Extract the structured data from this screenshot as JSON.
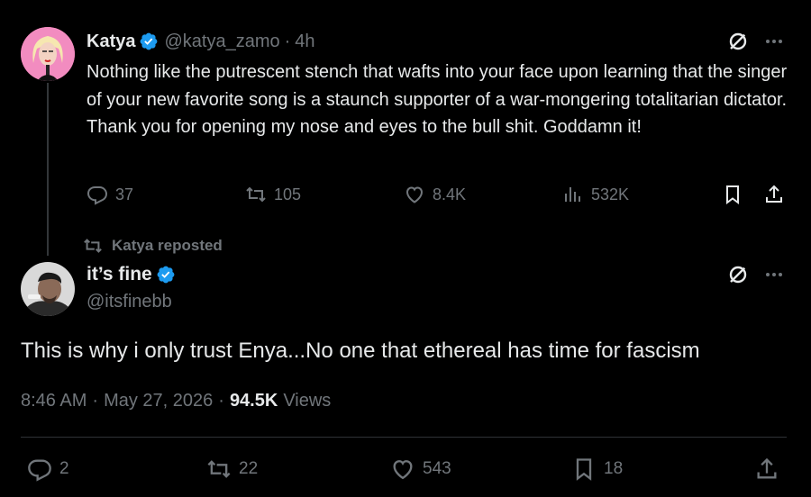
{
  "colors": {
    "background": "#000000",
    "text_primary": "#e7e9ea",
    "text_secondary": "#71767b",
    "verified_badge": "#1d9bf0",
    "divider": "#2f3336"
  },
  "quoted_tweet": {
    "author_name": "Katya",
    "verified": true,
    "handle": "@katya_zamo",
    "separator": "·",
    "time": "4h",
    "text": "Nothing like the putrescent stench that wafts into your face upon learning that the singer of your new favorite song is a staunch supporter of a war-mongering totalitarian dictator. Thank you for opening my nose and eyes to the bull shit. Goddamn it!",
    "actions": {
      "replies": "37",
      "reposts": "105",
      "likes": "8.4K",
      "views": "532K"
    },
    "icons": [
      "grok-icon",
      "more-icon",
      "reply-icon",
      "repost-icon",
      "like-icon",
      "views-icon",
      "bookmark-icon",
      "share-icon"
    ]
  },
  "repost_indicator": {
    "label": "Katya reposted"
  },
  "main_tweet": {
    "author_name": "it’s fine",
    "verified": true,
    "handle": "@itsfinebb",
    "text": "This is why i only trust Enya...No one that ethereal has time for fascism",
    "time": "8:46 AM",
    "separator": "·",
    "date": "May 27, 2026",
    "views_count": "94.5K",
    "views_label": "Views",
    "actions": {
      "replies": "2",
      "reposts": "22",
      "likes": "543",
      "bookmarks": "18"
    }
  }
}
